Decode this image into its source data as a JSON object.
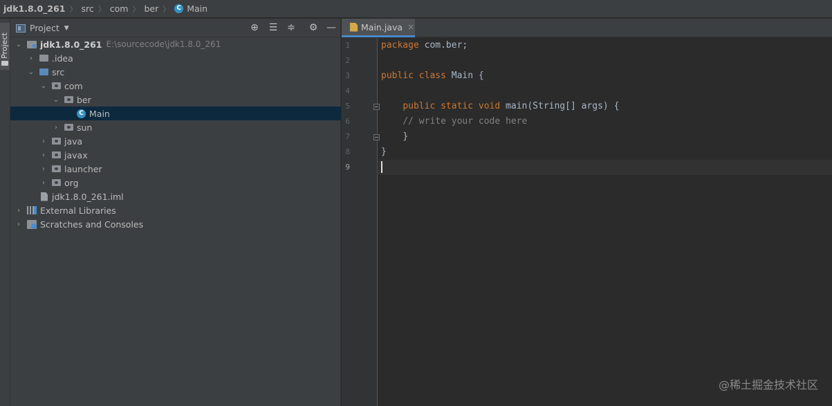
{
  "breadcrumb": {
    "items": [
      "jdk1.8.0_261",
      "src",
      "com",
      "ber",
      "Main"
    ],
    "class_icon_letter": "C"
  },
  "tool_strip": {
    "project_tab_label": "Project"
  },
  "project_panel": {
    "title": "Project",
    "dropdown_icon": "chevron-down-icon",
    "header_icons": [
      "locate-icon",
      "expand-all-icon",
      "collapse-all-icon",
      "gear-icon",
      "minimize-icon"
    ],
    "tree": [
      {
        "label": "jdk1.8.0_261",
        "hint": "E:\\sourcecode\\jdk1.8.0_261",
        "icon": "module-icon",
        "expanded": true
      },
      {
        "label": ".idea",
        "icon": "folder-icon",
        "expanded": false
      },
      {
        "label": "src",
        "icon": "source-folder-icon",
        "expanded": true
      },
      {
        "label": "com",
        "icon": "package-icon",
        "expanded": true
      },
      {
        "label": "ber",
        "icon": "package-icon",
        "expanded": true
      },
      {
        "label": "Main",
        "icon": "class-icon",
        "selected": true
      },
      {
        "label": "sun",
        "icon": "package-icon",
        "expanded": false
      },
      {
        "label": "java",
        "icon": "package-icon",
        "expanded": false
      },
      {
        "label": "javax",
        "icon": "package-icon",
        "expanded": false
      },
      {
        "label": "launcher",
        "icon": "package-icon",
        "expanded": false
      },
      {
        "label": "org",
        "icon": "package-icon",
        "expanded": false
      },
      {
        "label": "jdk1.8.0_261.iml",
        "icon": "file-icon"
      },
      {
        "label": "External Libraries",
        "icon": "libraries-icon",
        "expanded": false
      },
      {
        "label": "Scratches and Consoles",
        "icon": "scratches-icon",
        "expanded": false
      }
    ]
  },
  "editor": {
    "tab": {
      "label": "Main.java",
      "close": "×",
      "icon": "java-file-icon"
    },
    "line_numbers": [
      "1",
      "2",
      "3",
      "4",
      "5",
      "6",
      "7",
      "8",
      "9"
    ],
    "current_line": 9,
    "code": {
      "l1_kw": "package",
      "l1_rest": " com.ber;",
      "l3_kw": "public class",
      "l3_rest": " Main {",
      "l5_kw": "public static void",
      "l5_rest": " main(String[] args) {",
      "l6_comment": "// write your code here",
      "l7": "}",
      "l8": "}"
    }
  },
  "watermark": "@稀土掘金技术社区",
  "colors": {
    "background": "#2b2b2b",
    "panel": "#3c3f41",
    "selection": "#0d293e",
    "keyword": "#cc7832",
    "comment": "#808080",
    "accent": "#4a88c7"
  }
}
